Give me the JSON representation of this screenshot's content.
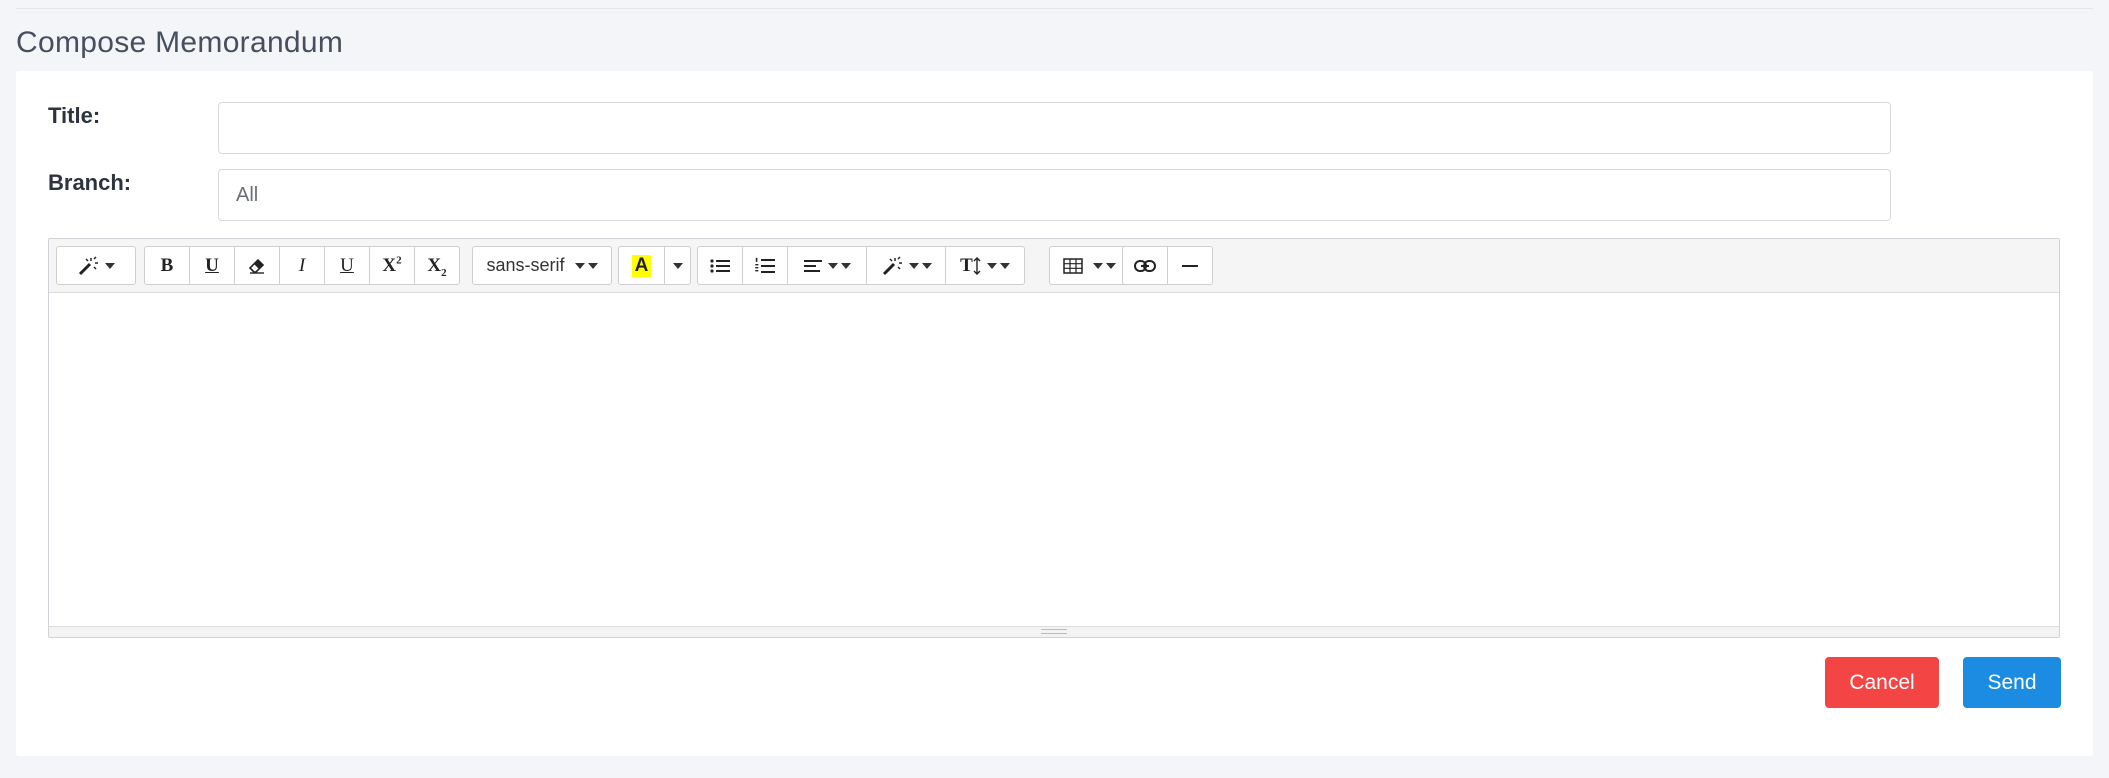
{
  "page": {
    "title": "Compose Memorandum"
  },
  "form": {
    "title_label": "Title:",
    "title_value": "",
    "branch_label": "Branch:",
    "branch_placeholder": "All"
  },
  "toolbar": {
    "font_name": "sans-serif",
    "highlight_glyph": "A",
    "bold": "B",
    "underline": "U",
    "italic": "I",
    "underline2": "U",
    "superscript": "X",
    "subscript": "X",
    "sup_mark": "2",
    "sub_mark": "2",
    "font_size_glyph": "T"
  },
  "actions": {
    "cancel": "Cancel",
    "send": "Send"
  },
  "colors": {
    "cancel": "#f44545",
    "send": "#1c8ce3",
    "highlight": "#ffff00"
  }
}
